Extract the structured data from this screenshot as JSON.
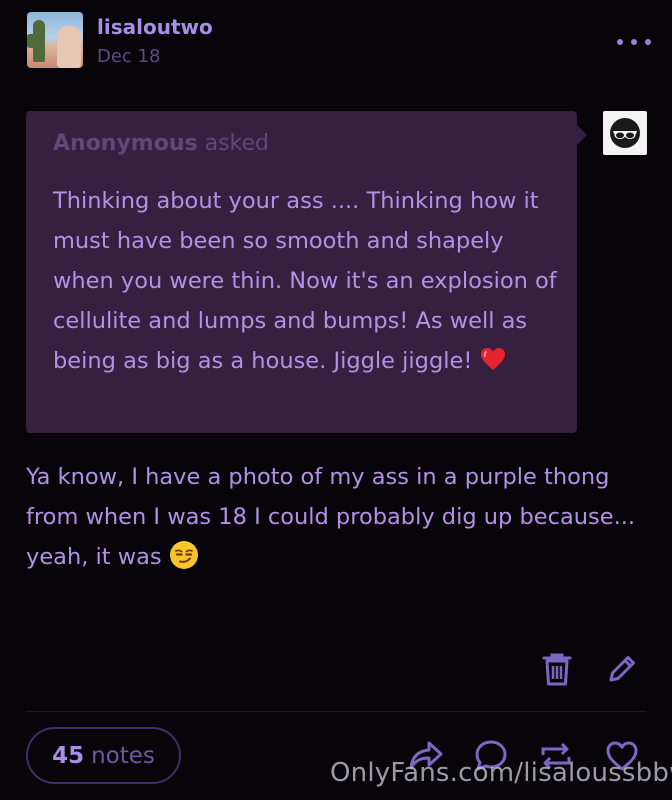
{
  "post": {
    "username": "lisaloutwo",
    "date": "Dec 18"
  },
  "ask": {
    "asker": "Anonymous",
    "verb": "asked",
    "question": "Thinking about your ass .... Thinking how it must have been so smooth and shapely when you were thin. Now it's an explosion of cellulite and lumps and bumps! As well as being as big as a house. Jiggle jiggle!"
  },
  "answer": {
    "text": "Ya know, I have a photo of my ass in a purple thong from when I was 18 I could probably dig up because... yeah, it was"
  },
  "footer": {
    "notes_count": "45",
    "notes_label": "notes"
  },
  "watermark": "OnlyFans.com/lisaloussbbw",
  "icons": {
    "more": "more-dots-icon",
    "delete": "trash-icon",
    "edit": "pencil-icon",
    "share": "share-icon",
    "reply": "comment-icon",
    "reblog": "reblog-icon",
    "like": "heart-icon"
  },
  "colors": {
    "accent": "#a98ee9",
    "card": "#35213f",
    "background": "#070509"
  }
}
